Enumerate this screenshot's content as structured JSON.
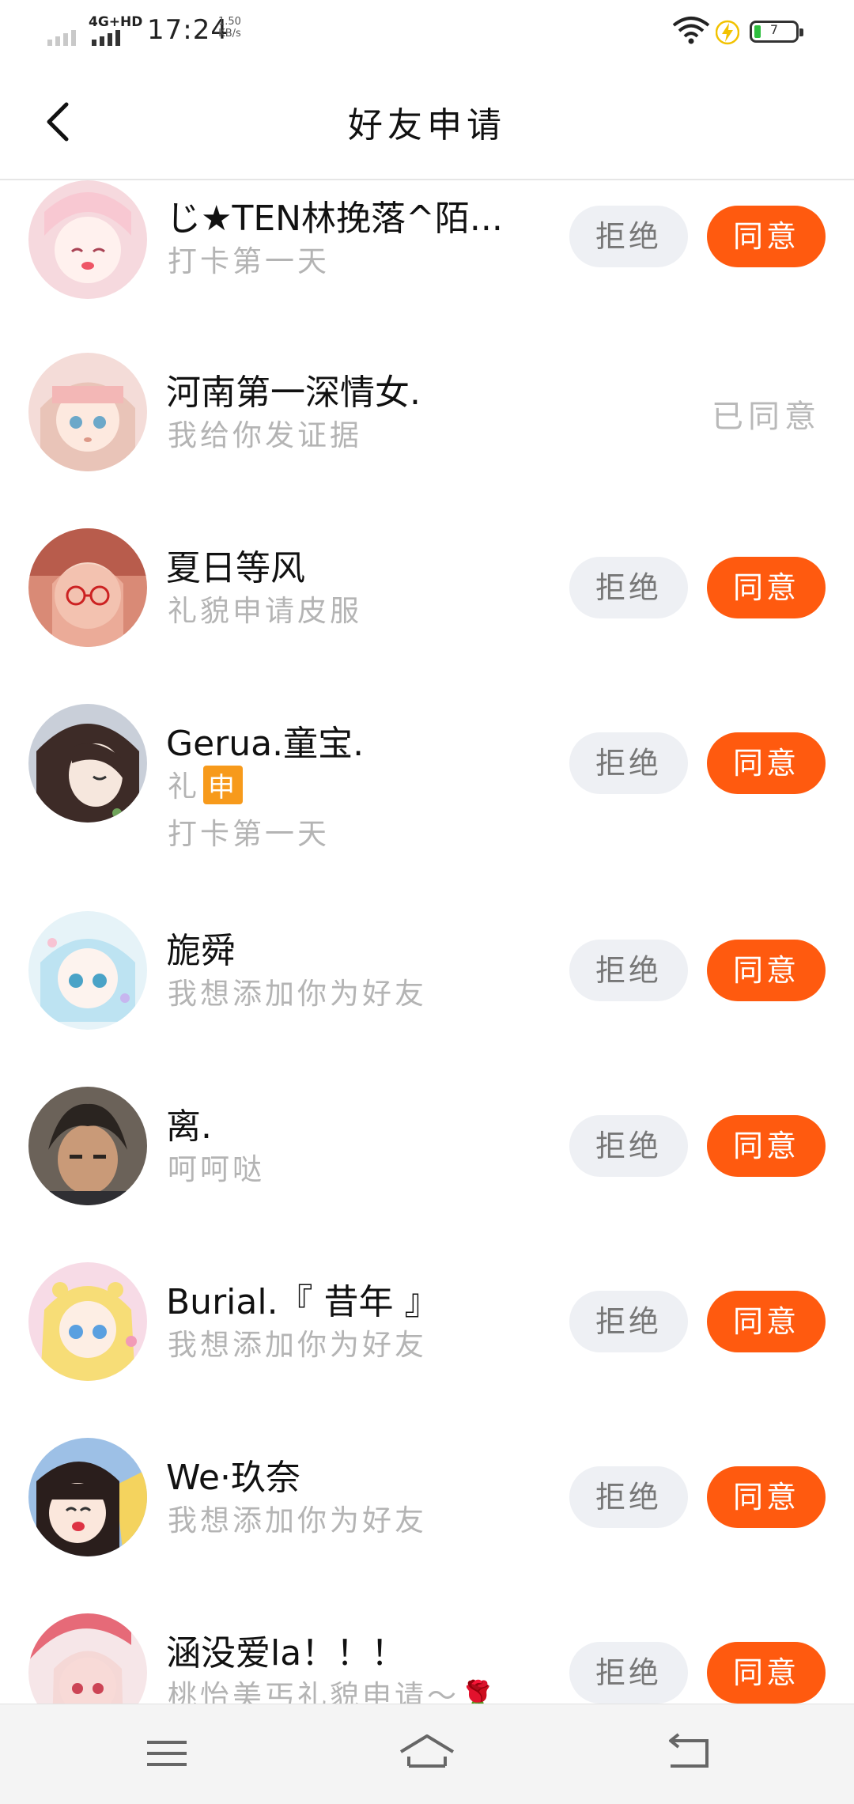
{
  "status_bar": {
    "network": "4G+HD",
    "time": "17:24",
    "speed_value": "1.50",
    "speed_unit": "KB/s",
    "battery_level": "7"
  },
  "header": {
    "title": "好友申请"
  },
  "buttons": {
    "reject_label": "拒绝",
    "accept_label": "同意",
    "agreed_label": "已同意"
  },
  "requests": [
    {
      "name": "じ★TEN林挽落^陌...",
      "message": "打卡第一天",
      "status": "pending"
    },
    {
      "name": "河南第一深情女.",
      "message": "我给你发证据",
      "status": "agreed"
    },
    {
      "name": "夏日等风",
      "message": "礼貌申请皮服",
      "status": "pending"
    },
    {
      "name": "Gerua.童宝.",
      "message": "礼",
      "tag": "申",
      "message2": "打卡第一天",
      "status": "pending"
    },
    {
      "name": "旎舜",
      "message": "我想添加你为好友",
      "status": "pending"
    },
    {
      "name": "离.",
      "message": "呵呵哒",
      "status": "pending"
    },
    {
      "name": "Burial.『 昔年 』",
      "message": "我想添加你为好友",
      "status": "pending"
    },
    {
      "name": "We·玖奈",
      "message": "我想添加你为好友",
      "status": "pending"
    },
    {
      "name": "涵没爱la！！！",
      "message": "桃怡美丐礼貌申请～🌹",
      "status": "pending"
    }
  ],
  "colors": {
    "accent": "#ff5a0f",
    "reject_bg": "#eef0f4",
    "muted_text": "#b4b4b4"
  }
}
